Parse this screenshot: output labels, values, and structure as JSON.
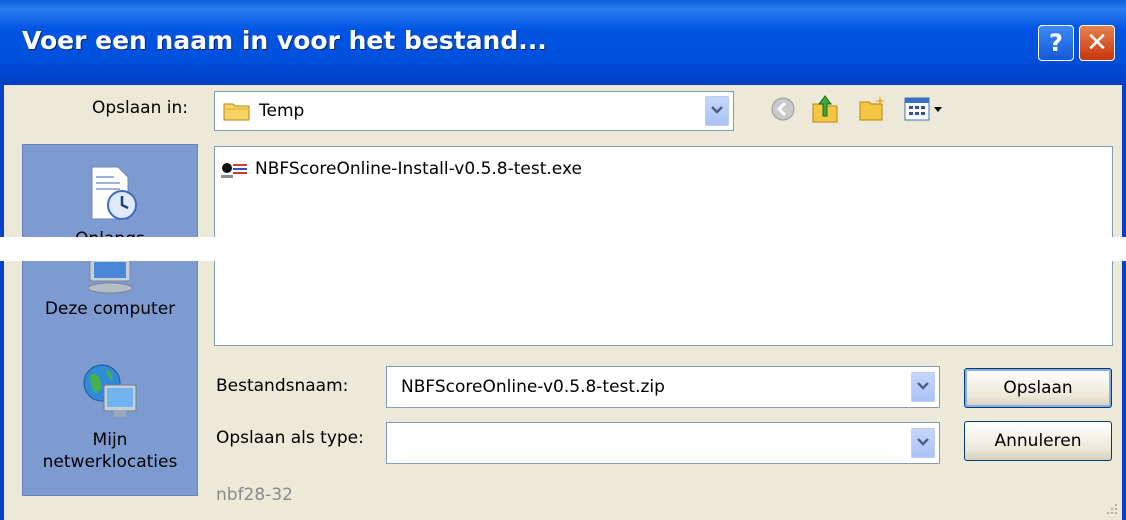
{
  "window": {
    "title": "Voer een naam in voor het bestand...",
    "help_label": "?",
    "close_label": "✕"
  },
  "location": {
    "label": "Opslaan in:",
    "value": "Temp"
  },
  "toolbar": {
    "icons": [
      "back-icon",
      "up-folder-icon",
      "new-folder-icon",
      "view-menu-icon"
    ]
  },
  "places": [
    {
      "label": "Onlangs",
      "icon": "recent-documents-icon"
    },
    {
      "label": "Deze computer",
      "icon": "my-computer-icon"
    },
    {
      "label": "Mijn netwerklocaties",
      "icon": "network-places-icon"
    }
  ],
  "files": [
    {
      "name": "NBFScoreOnline-Install-v0.5.8-test.exe",
      "icon": "installer-exe-icon"
    }
  ],
  "filename": {
    "label": "Bestandsnaam:",
    "value": "NBFScoreOnline-v0.5.8-test.zip"
  },
  "filetype": {
    "label": "Opslaan als type:",
    "value": ""
  },
  "buttons": {
    "save": "Opslaan",
    "cancel": "Annuleren"
  },
  "footer": {
    "text": "nbf28-32"
  },
  "colors": {
    "titlebar": "#0054e3",
    "dialog_bg": "#ece9d8",
    "places_bg": "#7d9bd1"
  }
}
